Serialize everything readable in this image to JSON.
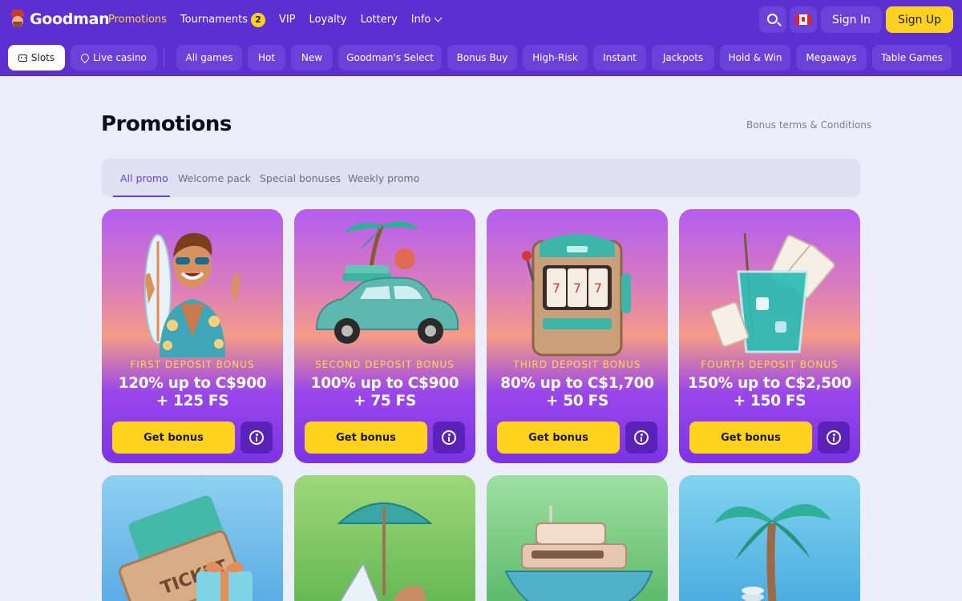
{
  "brand": {
    "name": "Goodman"
  },
  "nav": {
    "items": [
      {
        "label": "Promotions",
        "active": true
      },
      {
        "label": "Tournaments",
        "badge": "2"
      },
      {
        "label": "VIP"
      },
      {
        "label": "Loyalty"
      },
      {
        "label": "Lottery"
      },
      {
        "label": "Info",
        "dropdown": true
      }
    ],
    "search_icon": "search-icon",
    "language_flag": "canada-flag-icon",
    "signin_label": "Sign In",
    "signup_label": "Sign Up"
  },
  "categories": {
    "primary": [
      {
        "label": "Slots",
        "icon": "slot-machine-icon",
        "active": true
      },
      {
        "label": "Live casino",
        "icon": "club-icon"
      }
    ],
    "filters": [
      "All games",
      "Hot",
      "New",
      "Goodman's Select",
      "Bonus Buy",
      "High-Risk",
      "Instant",
      "Jackpots",
      "Hold & Win",
      "Megaways",
      "Table Games"
    ]
  },
  "page": {
    "title": "Promotions",
    "terms_link": "Bonus terms & Conditions"
  },
  "tabs": [
    "All promo",
    "Welcome pack",
    "Special bonuses",
    "Weekly promo"
  ],
  "promos": [
    {
      "kicker": "FIRST DEPOSIT BONUS",
      "offer": "120% up to C$900 + 125 FS",
      "button": "Get bonus",
      "art": "surfer-man-illustration"
    },
    {
      "kicker": "SECOND DEPOSIT BONUS",
      "offer": "100% up to C$900 + 75 FS",
      "button": "Get bonus",
      "art": "vacation-car-illustration"
    },
    {
      "kicker": "THIRD DEPOSIT BONUS",
      "offer": "80% up to C$1,700 + 50 FS",
      "button": "Get bonus",
      "art": "slot-machine-illustration"
    },
    {
      "kicker": "FOURTH DEPOSIT BONUS",
      "offer": "150% up to C$2,500 + 150 FS",
      "button": "Get bonus",
      "art": "cocktail-cards-illustration"
    }
  ],
  "promos_row2": [
    {
      "art": "ticket-gift-illustration",
      "ticket_text": "TICKET"
    },
    {
      "art": "beach-umbrella-illustration"
    },
    {
      "art": "yacht-illustration"
    },
    {
      "art": "palm-coins-illustration"
    }
  ],
  "colors": {
    "header_bg": "#5b2fd0",
    "button_bg": "#6a42da",
    "accent_yellow": "#ffd21f",
    "page_bg": "#eceefb",
    "tab_active": "#6a3fd6"
  }
}
